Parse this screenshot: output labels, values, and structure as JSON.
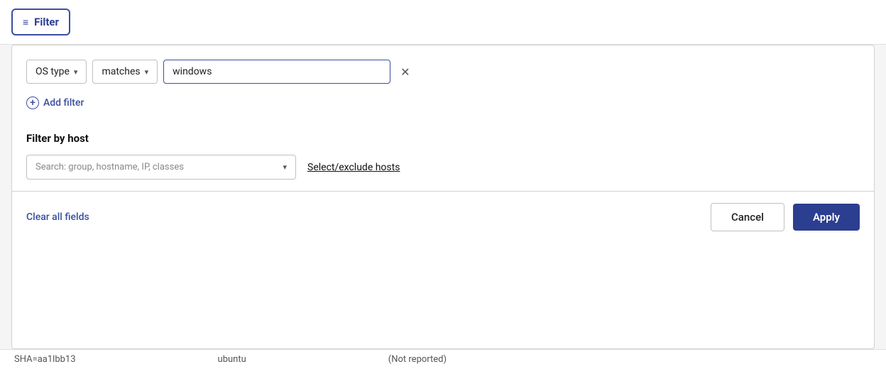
{
  "filter_button": {
    "label": "Filter",
    "icon": "≡"
  },
  "filter_row": {
    "os_type_label": "OS type",
    "matches_label": "matches",
    "value": "windows",
    "clear_icon": "×"
  },
  "add_filter": {
    "label": "Add filter"
  },
  "filter_by_host": {
    "title": "Filter by host",
    "search_placeholder": "Search: group, hostname, IP, classes",
    "select_exclude_label": "Select/exclude hosts"
  },
  "footer": {
    "clear_all_label": "Clear all fields",
    "cancel_label": "Cancel",
    "apply_label": "Apply"
  },
  "bottom_peek": {
    "col1": "SHA=aa1lbb13",
    "col2": "ubuntu",
    "col3": "(Not reported)"
  }
}
